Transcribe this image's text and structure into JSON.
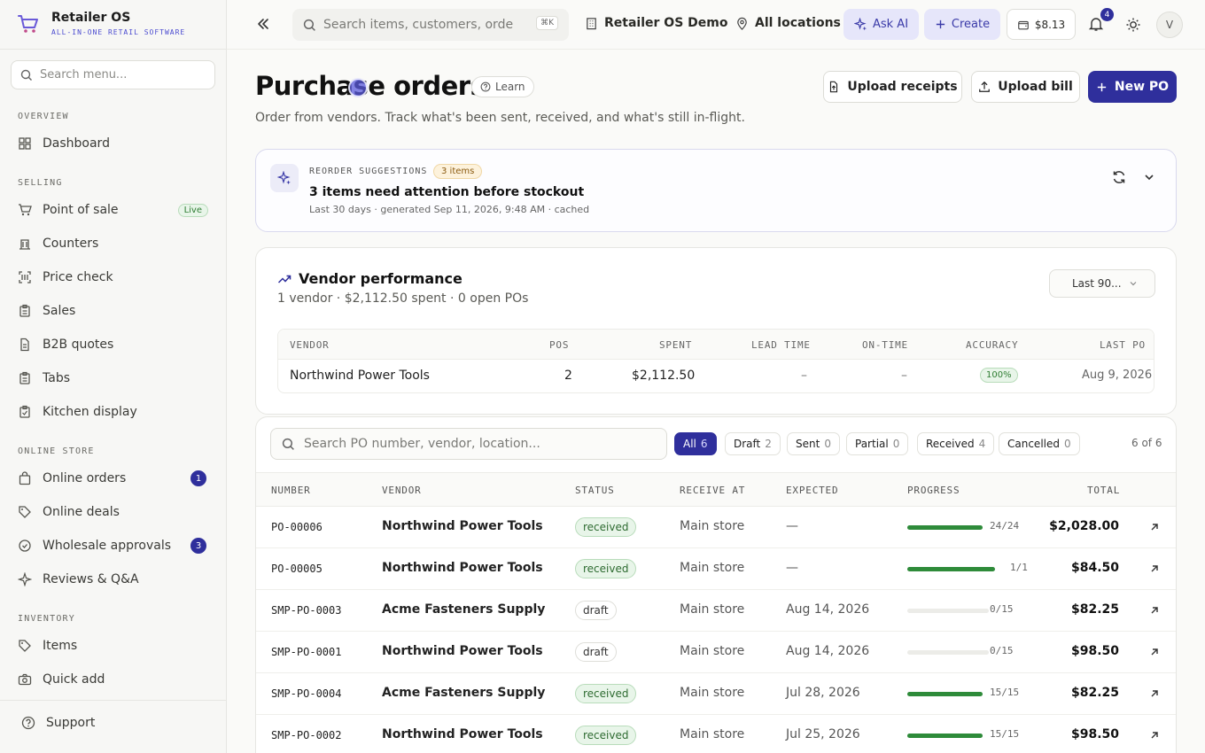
{
  "brand": {
    "name": "Retailer OS",
    "tagline": "ALL-IN-ONE RETAIL SOFTWARE"
  },
  "sidebar": {
    "search_placeholder": "Search menu...",
    "sections": [
      {
        "title": "OVERVIEW",
        "items": [
          {
            "label": "Dashboard",
            "icon": "dashboard-icon"
          }
        ]
      },
      {
        "title": "SELLING",
        "items": [
          {
            "label": "Point of sale",
            "icon": "cart-icon",
            "badge": "Live"
          },
          {
            "label": "Counters",
            "icon": "counter-icon"
          },
          {
            "label": "Price check",
            "icon": "scan-icon"
          },
          {
            "label": "Sales",
            "icon": "clipboard-icon"
          },
          {
            "label": "B2B quotes",
            "icon": "document-icon"
          },
          {
            "label": "Tabs",
            "icon": "clipboard-icon"
          },
          {
            "label": "Kitchen display",
            "icon": "clipboard-check-icon"
          }
        ]
      },
      {
        "title": "ONLINE STORE",
        "items": [
          {
            "label": "Online orders",
            "icon": "bag-icon",
            "count": "1"
          },
          {
            "label": "Online deals",
            "icon": "tag-icon"
          },
          {
            "label": "Wholesale approvals",
            "icon": "check-circle-icon",
            "count": "3"
          },
          {
            "label": "Reviews & Q&A",
            "icon": "sparkle-icon"
          }
        ]
      },
      {
        "title": "INVENTORY",
        "items": [
          {
            "label": "Items",
            "icon": "tag-icon"
          },
          {
            "label": "Quick add",
            "icon": "camera-icon"
          }
        ]
      }
    ],
    "support_label": "Support"
  },
  "topbar": {
    "search_placeholder": "Search items, customers, orde",
    "shortcut": "⌘K",
    "workspace": "Retailer OS Demo",
    "location": "All locations",
    "ask_ai": "Ask AI",
    "create": "Create",
    "wallet": "$8.13",
    "notifications": "4",
    "avatar": "V"
  },
  "page": {
    "title": "Purchase orders",
    "learn": "Learn",
    "subtitle": "Order from vendors. Track what's been sent, received, and what's still in-flight.",
    "actions": {
      "upload_receipts": "Upload receipts",
      "upload_bill": "Upload bill",
      "new_po": "New PO"
    }
  },
  "reorder": {
    "label": "REORDER SUGGESTIONS",
    "badge": "3 items",
    "title": "3 items need attention before stockout",
    "meta": "Last 30 days · generated Sep 11, 2026, 9:48 AM · cached"
  },
  "vendor_perf": {
    "title": "Vendor performance",
    "subtitle": "1 vendor · $2,112.50 spent · 0 open POs",
    "range": "Last 90...",
    "columns": [
      "VENDOR",
      "POS",
      "SPENT",
      "LEAD TIME",
      "ON-TIME",
      "ACCURACY",
      "LAST PO"
    ],
    "row": {
      "vendor": "Northwind Power Tools",
      "pos": "2",
      "spent": "$2,112.50",
      "lead_time": "–",
      "on_time": "–",
      "accuracy": "100%",
      "last_po": "Aug 9, 2026"
    }
  },
  "po": {
    "search_placeholder": "Search PO number, vendor, location...",
    "filters": [
      {
        "label": "All",
        "count": "6",
        "active": true
      },
      {
        "label": "Draft",
        "count": "2"
      },
      {
        "label": "Sent",
        "count": "0"
      },
      {
        "label": "Partial",
        "count": "0"
      },
      {
        "label": "Received",
        "count": "4"
      },
      {
        "label": "Cancelled",
        "count": "0"
      }
    ],
    "count_label": "6 of 6",
    "columns": [
      "NUMBER",
      "VENDOR",
      "STATUS",
      "RECEIVE AT",
      "EXPECTED",
      "PROGRESS",
      "TOTAL"
    ],
    "rows": [
      {
        "number": "PO-00006",
        "vendor": "Northwind Power Tools",
        "status": "received",
        "receive_at": "Main store",
        "expected": "—",
        "progress": "24/24",
        "fraction": 1,
        "total": "$2,028.00"
      },
      {
        "number": "PO-00005",
        "vendor": "Northwind Power Tools",
        "status": "received",
        "receive_at": "Main store",
        "expected": "—",
        "progress": "1/1",
        "fraction": 1,
        "total": "$84.50"
      },
      {
        "number": "SMP-PO-0003",
        "vendor": "Acme Fasteners Supply",
        "status": "draft",
        "receive_at": "Main store",
        "expected": "Aug 14, 2026",
        "progress": "0/15",
        "fraction": 0,
        "total": "$82.25"
      },
      {
        "number": "SMP-PO-0001",
        "vendor": "Northwind Power Tools",
        "status": "draft",
        "receive_at": "Main store",
        "expected": "Aug 14, 2026",
        "progress": "0/15",
        "fraction": 0,
        "total": "$98.50"
      },
      {
        "number": "SMP-PO-0004",
        "vendor": "Acme Fasteners Supply",
        "status": "received",
        "receive_at": "Main store",
        "expected": "Jul 28, 2026",
        "progress": "15/15",
        "fraction": 1,
        "total": "$82.25"
      },
      {
        "number": "SMP-PO-0002",
        "vendor": "Northwind Power Tools",
        "status": "received",
        "receive_at": "Main store",
        "expected": "Jul 25, 2026",
        "progress": "15/15",
        "fraction": 1,
        "total": "$98.50"
      }
    ]
  }
}
